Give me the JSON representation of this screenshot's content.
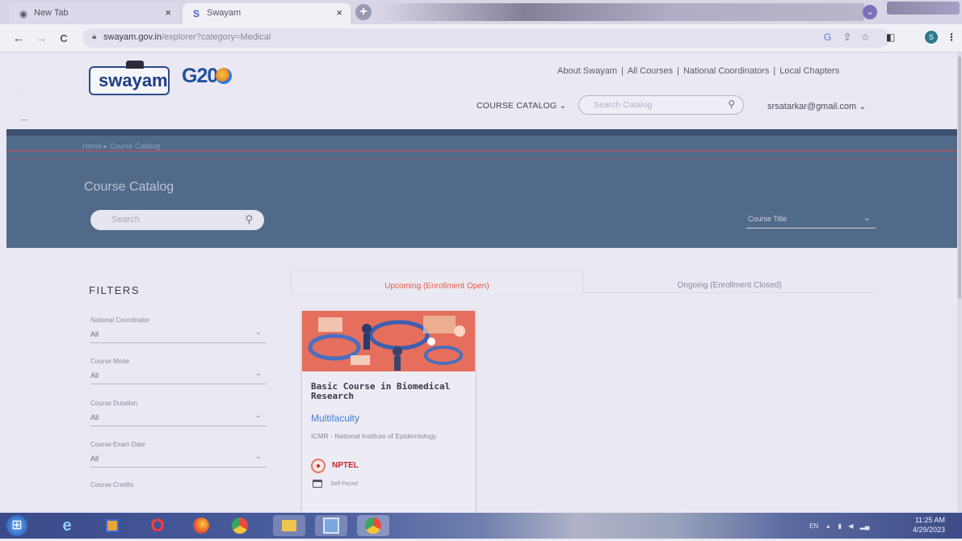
{
  "browser": {
    "tabs": [
      {
        "title": "New Tab",
        "close": "×"
      },
      {
        "title": "Swayam",
        "close": "×"
      }
    ],
    "new_tab_icon": "+",
    "nav": {
      "back": "←",
      "forward": "→",
      "reload": "C"
    },
    "url": {
      "host": "swayam.gov.in",
      "path": "/explorer?category=Medical"
    }
  },
  "header": {
    "logo_text": "swayam",
    "g20_text": "G20",
    "top_links": [
      "About Swayam",
      "All Courses",
      "National Coordinators",
      "Local Chapters"
    ],
    "top_links_separator": "|",
    "course_catalog_menu": "COURSE CATALOG",
    "search_placeholder": "Search Catalog",
    "user_email": "srsatarkar@gmail.com"
  },
  "banner": {
    "breadcrumb": "Home ▸ Course Catalog",
    "title": "Course Catalog",
    "search_placeholder": "Search",
    "sort_label": "Course Title"
  },
  "filters": {
    "title": "FILTERS",
    "items": [
      {
        "label": "National Coordinator",
        "value": "All"
      },
      {
        "label": "Course Mode",
        "value": "All"
      },
      {
        "label": "Course Duration",
        "value": "All"
      },
      {
        "label": "Course Exam Date",
        "value": "All"
      },
      {
        "label": "Course Credits",
        "value": ""
      }
    ]
  },
  "tabs": {
    "upcoming": "Upcoming (Enrollment Open)",
    "ongoing": "Ongoing (Enrollment Closed)"
  },
  "course": {
    "title": "Basic Course in Biomedical Research",
    "category": "Multifaculty",
    "institute": "ICMR - National Institute of Epidemiology",
    "provider": "NPTEL",
    "pacing": "Self Paced"
  },
  "taskbar": {
    "tray_lang": "EN",
    "time": "11:25 AM",
    "date": "4/29/2023"
  },
  "colors": {
    "banner": "#526a8a",
    "accent_tab": "#e85b4a",
    "link_blue": "#3f7fd6",
    "nptel_red": "#c8282c"
  }
}
